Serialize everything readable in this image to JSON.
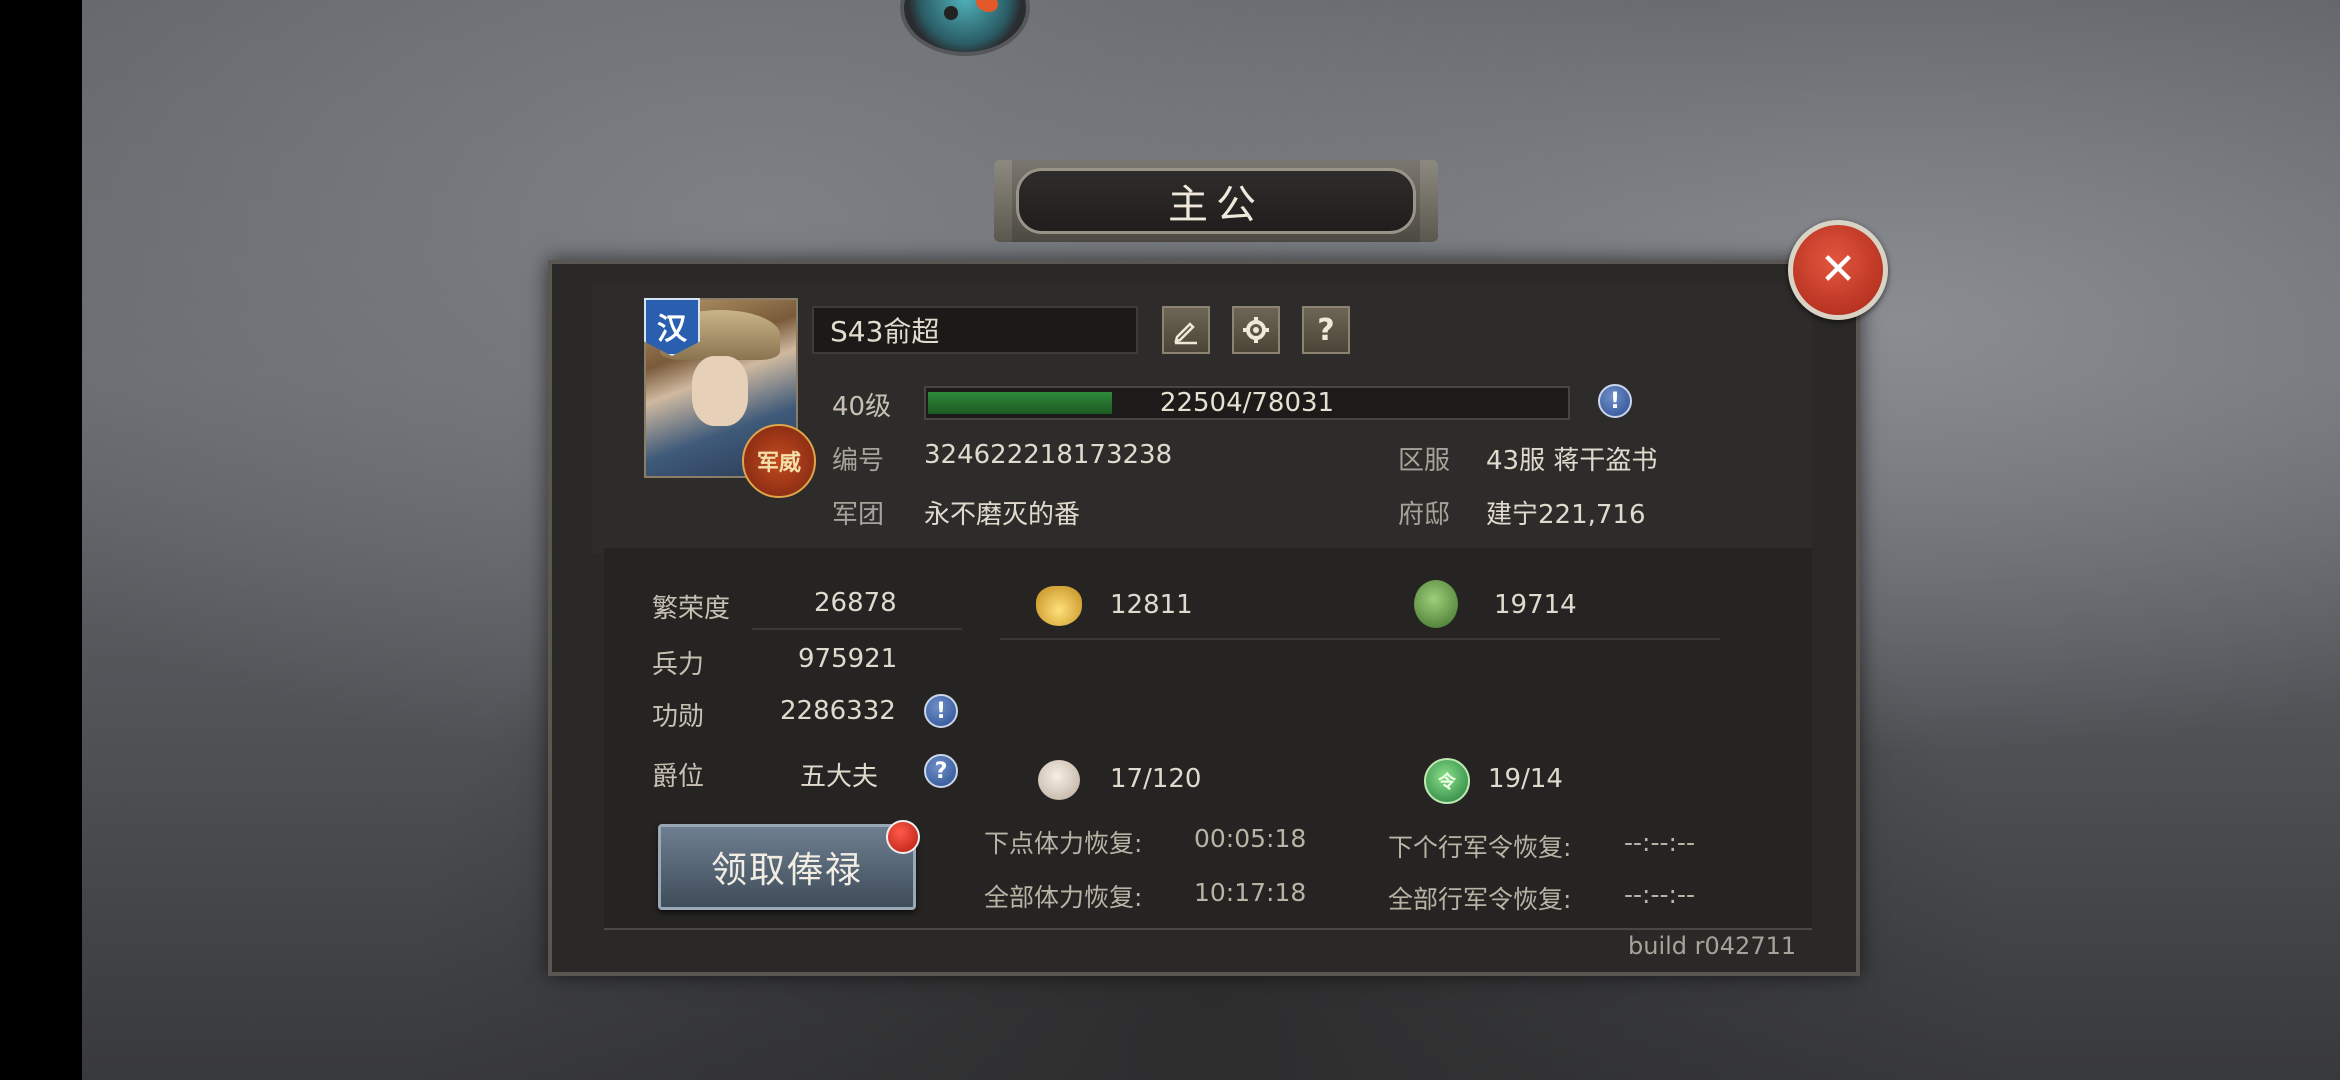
{
  "window": {
    "title": "主公"
  },
  "profile": {
    "faction": "汉",
    "rank_badge": "军威",
    "name": "S43俞超",
    "level_label": "40级",
    "xp": {
      "current": 22504,
      "max": 78031,
      "text": "22504/78031"
    },
    "id_label": "编号",
    "id_value": "324622218173238",
    "server_label": "区服",
    "server_value": "43服 蒋干盗书",
    "legion_label": "军团",
    "legion_value": "永不磨灭的番",
    "residence_label": "府邸",
    "residence_value": "建宁221,716"
  },
  "header_buttons": {
    "edit_icon": "pencil-icon",
    "settings_icon": "gear-icon",
    "help": "?"
  },
  "stats": [
    {
      "label": "繁荣度",
      "value": "26878"
    },
    {
      "label": "兵力",
      "value": "975921"
    },
    {
      "label": "功勋",
      "value": "2286332"
    },
    {
      "label": "爵位",
      "value": "五大夫"
    }
  ],
  "claim_button": "领取俸禄",
  "resources": {
    "gold": "12811",
    "jade": "19714",
    "stamina": "17/120",
    "march_orders": "19/14"
  },
  "recovery": {
    "next_stamina_label": "下点体力恢复:",
    "next_stamina_value": "00:05:18",
    "all_stamina_label": "全部体力恢复:",
    "all_stamina_value": "10:17:18",
    "next_order_label": "下个行军令恢复:",
    "next_order_value": "--:--:--",
    "all_order_label": "全部行军令恢复:",
    "all_order_value": "--:--:--"
  },
  "token_glyph": "令",
  "build": "build r042711",
  "colors": {
    "accent_green": "#2f8a3a",
    "close_red": "#c8341f",
    "info_blue": "#2c4f92"
  }
}
